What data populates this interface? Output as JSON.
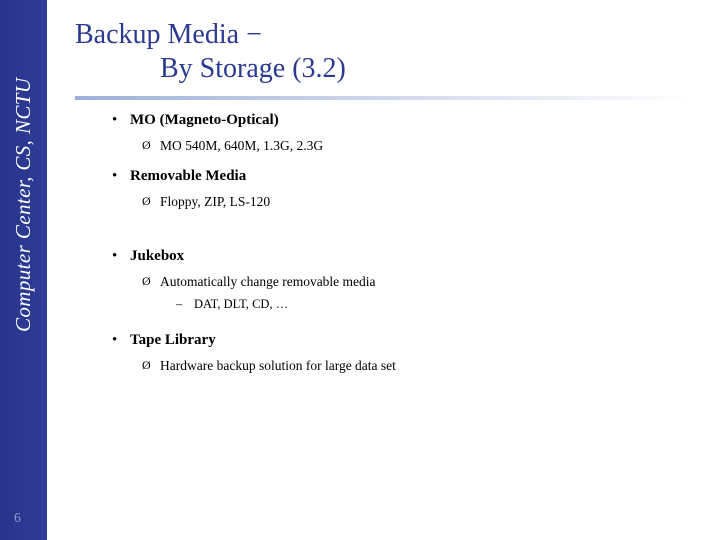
{
  "sidebar": {
    "label": "Computer Center, CS, NCTU",
    "page_number": "6",
    "color": "#2b3a8f"
  },
  "title": {
    "line1": "Backup Media −",
    "line2": "By Storage (3.2)",
    "color": "#2b3a8f"
  },
  "bullets": {
    "level1_glyph": "•",
    "level2_glyph": "Ø",
    "level3_glyph": "–"
  },
  "content": [
    {
      "level": 1,
      "text": "MO (Magneto-Optical)",
      "children": [
        {
          "level": 2,
          "text": "MO 540M, 640M, 1.3G, 2.3G"
        }
      ]
    },
    {
      "level": 1,
      "text": "Removable Media",
      "children": [
        {
          "level": 2,
          "text": "Floppy, ZIP, LS-120"
        }
      ]
    },
    {
      "level": 1,
      "text": "Jukebox",
      "children": [
        {
          "level": 2,
          "text": "Automatically change removable media"
        },
        {
          "level": 3,
          "text": "DAT, DLT, CD, …"
        }
      ]
    },
    {
      "level": 1,
      "text": "Tape Library",
      "children": [
        {
          "level": 2,
          "text": "Hardware backup solution for large data set"
        }
      ]
    }
  ],
  "flat_lines": {
    "l1_mo": "MO (Magneto-Optical)",
    "l2_mo": "MO 540M, 640M, 1.3G, 2.3G",
    "l1_removable": "Removable Media",
    "l2_removable": "Floppy, ZIP, LS-120",
    "l1_jukebox": "Jukebox",
    "l2_jukebox": "Automatically change removable media",
    "l3_jukebox": "DAT, DLT, CD, …",
    "l1_tape": "Tape Library",
    "l2_tape": "Hardware backup solution for large data set"
  }
}
